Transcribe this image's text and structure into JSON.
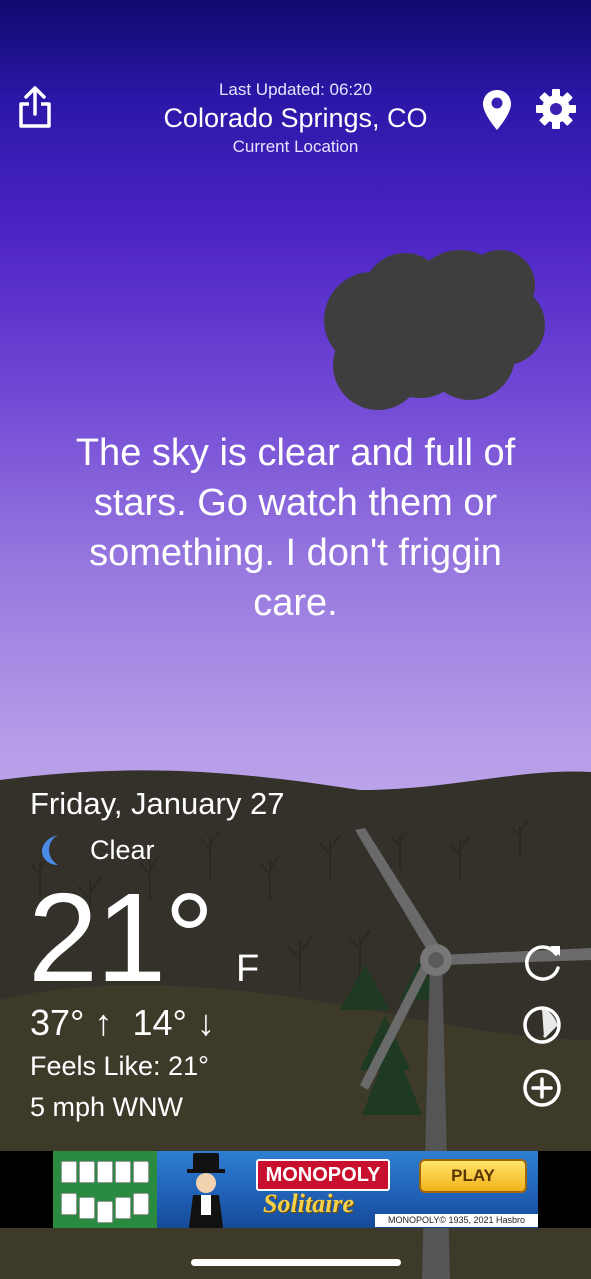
{
  "header": {
    "last_updated": "Last Updated: 06:20",
    "city": "Colorado Springs, CO",
    "location_label": "Current Location",
    "icons": [
      "share-icon",
      "location-pin-icon",
      "gear-icon"
    ]
  },
  "message": "The sky is clear and full of stars. Go watch them or something. I don't friggin care.",
  "weather": {
    "date": "Friday, January 27",
    "condition": "Clear",
    "condition_icon": "moon-icon",
    "temperature": "21°",
    "unit": "F",
    "high": "37°",
    "low": "14°",
    "high_arrow": "↑",
    "low_arrow": "↓",
    "feels_like": "Feels Like: 21°",
    "wind": "5 mph WNW"
  },
  "actions": [
    "refresh-icon",
    "radar-icon",
    "add-location-icon"
  ],
  "ad": {
    "brand": "MONOPOLY",
    "product": "Solitaire",
    "cta": "PLAY",
    "copyright": "MONOPOLY© 1935, 2021 Hasbro"
  },
  "colors": {
    "sky_top": "#0f0a6e",
    "sky_bottom": "#bba4ea",
    "ground": "#2e2c22",
    "cloud": "#3d3d3d",
    "ad_red": "#c8102e"
  }
}
